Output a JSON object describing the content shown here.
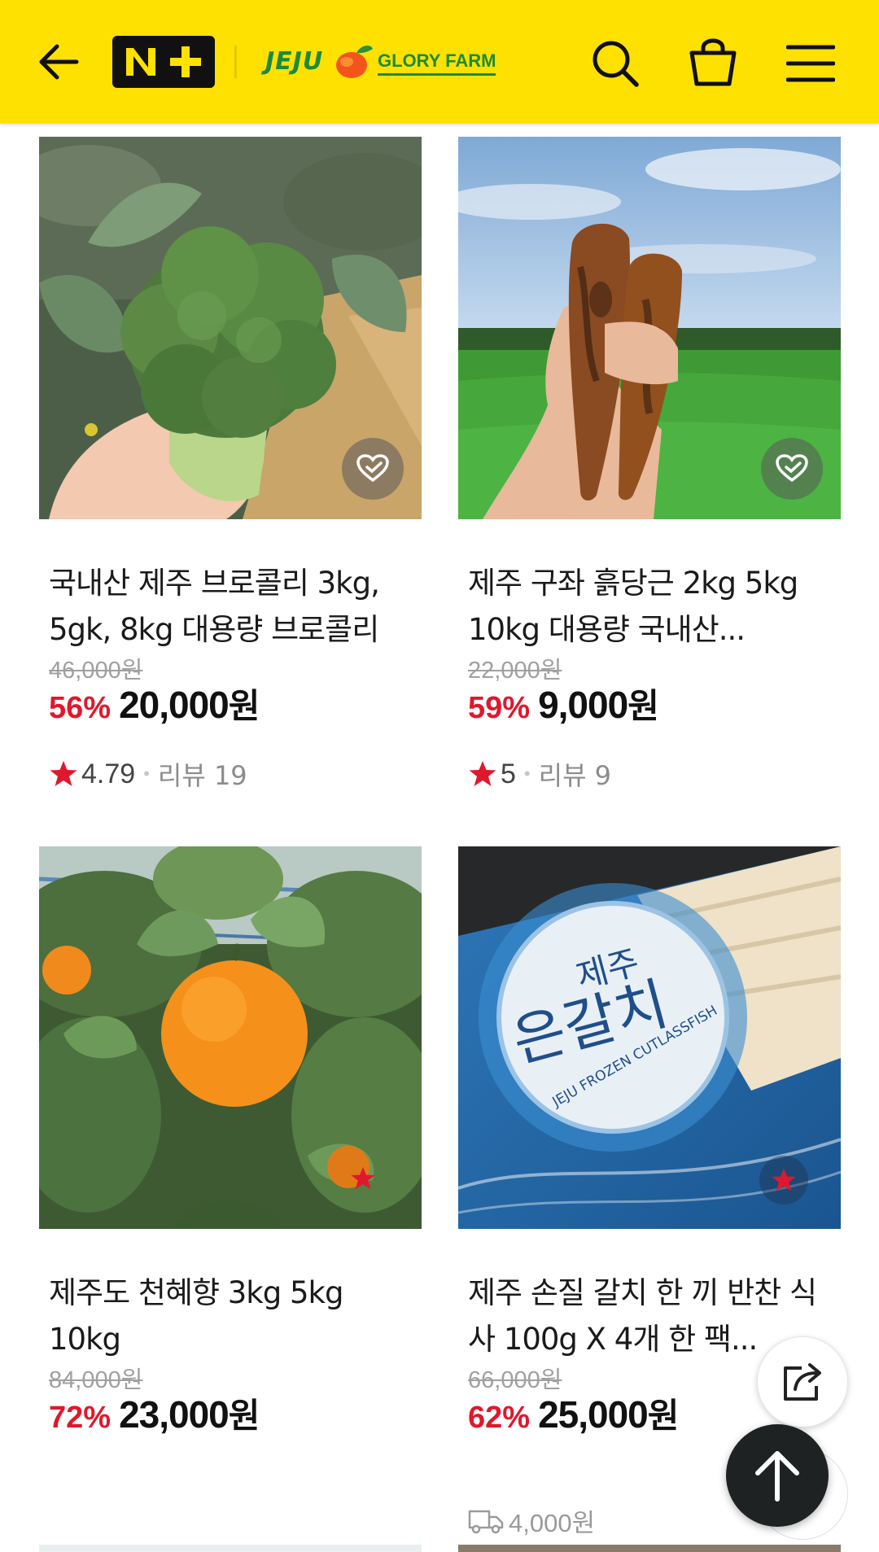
{
  "header": {
    "brand_logo": "N+",
    "shop_logo_left": "JEJU",
    "shop_logo_right": "GLORY FARM",
    "icons": [
      "arrow-left-icon",
      "search-icon",
      "shopping-bag-icon",
      "menu-icon"
    ],
    "background": "#FFE100"
  },
  "products": [
    {
      "title": "국내산 제주 브로콜리 3kg, 5gk, 8kg 대용량 브로콜리",
      "original_price": "46,000원",
      "discount": "56%",
      "price": "20,000",
      "currency": "원",
      "rating_icon": "star-icon",
      "rating": "4.79",
      "review_label": "리뷰 19"
    },
    {
      "title": "제주 구좌 흙당근 2kg 5kg 10kg 대용량 국내산...",
      "original_price": "22,000원",
      "discount": "59%",
      "price": "9,000",
      "currency": "원",
      "rating_icon": "star-icon",
      "rating": "5",
      "review_label": "리뷰 9"
    },
    {
      "title": "제주도 천혜향 3kg 5kg 10kg",
      "original_price": "84,000원",
      "discount": "72%",
      "price": "23,000",
      "currency": "원"
    },
    {
      "title": "제주 손질 갈치 한 끼 반찬 식사 100g X 4개 한 팩...",
      "original_price": "66,000원",
      "discount": "62%",
      "price": "25,000",
      "currency": "원",
      "shipping_icon": "delivery-truck-icon",
      "shipping_fee": "4,000원",
      "package_text_top": "제주",
      "package_text_main": "은갈치",
      "package_text_sub": "JEJU FROZEN CUTLASSFISH"
    }
  ],
  "colors": {
    "discount": "#E0182D",
    "star": "#E0182D",
    "header": "#FFE100",
    "top_button": "#1F2223"
  }
}
